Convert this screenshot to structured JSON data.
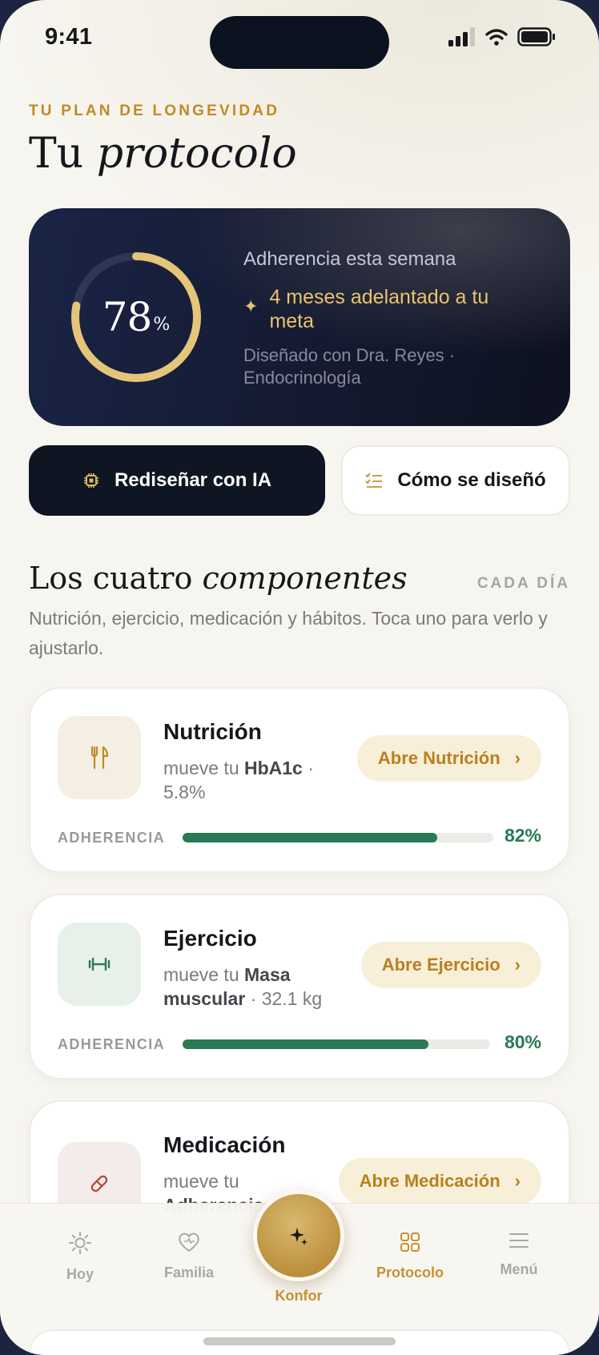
{
  "status": {
    "time": "9:41"
  },
  "header": {
    "eyebrow": "TU PLAN DE LONGEVIDAD",
    "title_plain": "Tu ",
    "title_italic": "protocolo"
  },
  "adherence": {
    "value": 78,
    "value_text": "78",
    "unit": "%",
    "label": "Adherencia esta semana",
    "ahead": "4 meses adelantado a tu meta",
    "designed_by": "Diseñado con Dra. Reyes · Endocrinología"
  },
  "actions": {
    "redesign": "Rediseñar con IA",
    "how": "Cómo se diseñó"
  },
  "section": {
    "title_plain": "Los cuatro ",
    "title_italic": "componentes",
    "tag": "CADA DÍA",
    "description": "Nutrición, ejercicio, medicación y hábitos. Toca uno para verlo y ajustarlo."
  },
  "components": [
    {
      "name": "Nutrición",
      "sub_prefix": "mueve tu ",
      "sub_bold": "HbA1c",
      "sub_suffix": " · 5.8%",
      "button": "Abre Nutrición",
      "adherence_label": "ADHERENCIA",
      "adherence": 0.82,
      "adherence_text": "82%",
      "icon": "fork-knife-icon"
    },
    {
      "name": "Ejercicio",
      "sub_prefix": "mueve tu ",
      "sub_bold": "Masa muscular",
      "sub_suffix": " · 32.1 kg",
      "button": "Abre Ejercicio",
      "adherence_label": "ADHERENCIA",
      "adherence": 0.8,
      "adherence_text": "80%",
      "icon": "dumbbell-icon"
    },
    {
      "name": "Medicación",
      "sub_prefix": "mueve tu ",
      "sub_bold": "Adherencia",
      "sub_suffix": "",
      "button": "Abre Medicación",
      "icon": "pill-icon"
    }
  ],
  "tabs": {
    "hoy": "Hoy",
    "familia": "Familia",
    "konfor": "Konfor",
    "protocolo": "Protocolo",
    "menu": "Menú"
  },
  "colors": {
    "accent": "#c49133",
    "green": "#2a7a55",
    "navy": "#141a30",
    "ring_gold": "#e4c57a"
  }
}
